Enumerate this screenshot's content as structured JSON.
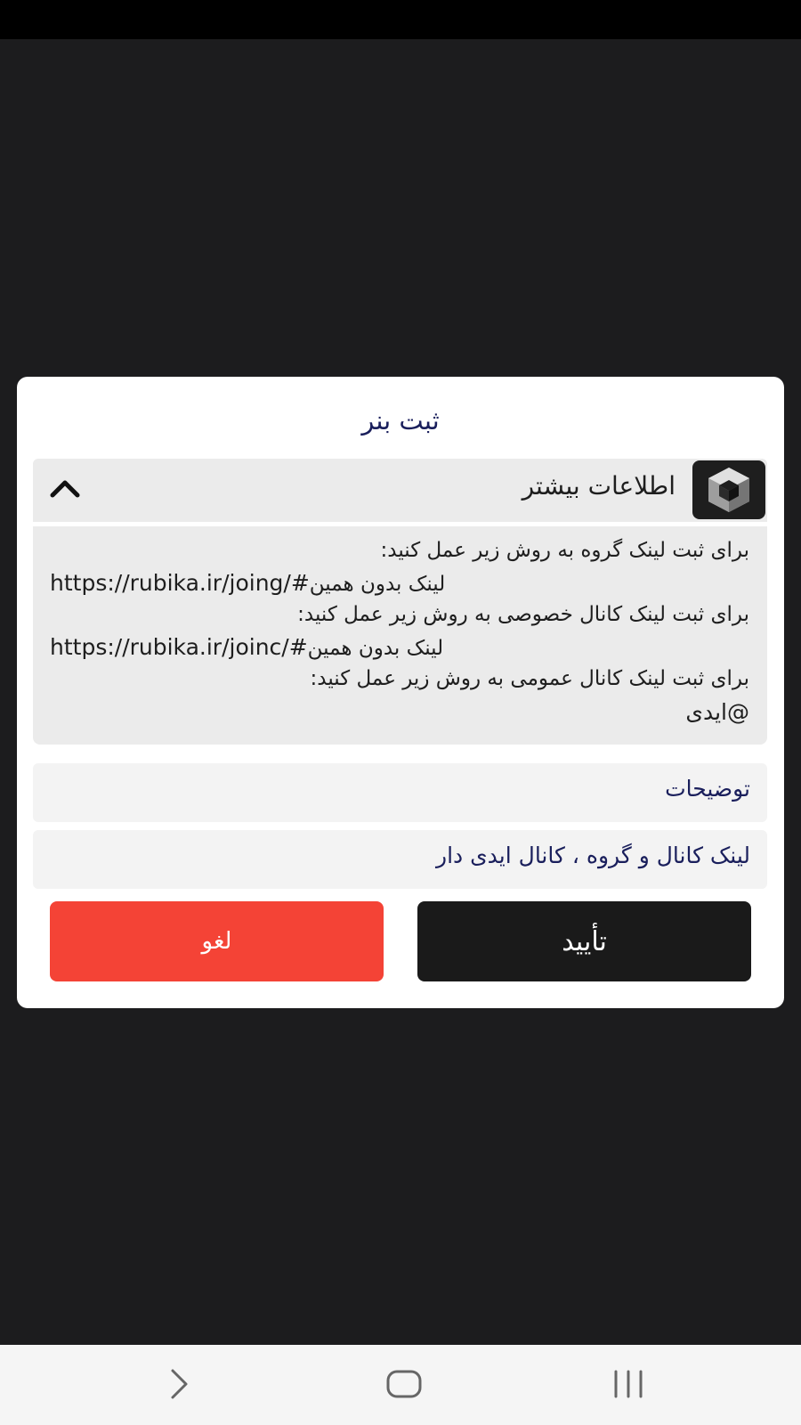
{
  "dialog": {
    "title": "ثبت بنر",
    "info_section": {
      "title": "اطلاعات بیشتر",
      "expanded": true,
      "lines": [
        {
          "text": "برای ثبت لینک گروه به روش زیر عمل کنید:"
        },
        {
          "url": "https://rubika.ir/joing/#",
          "suffix": "لینک بدون همین"
        },
        {
          "text": "برای ثبت لینک کانال خصوصی به روش زیر عمل کنید:"
        },
        {
          "url": "https://rubika.ir/joinc/#",
          "suffix": "لینک بدون همین"
        },
        {
          "text": "برای ثبت لینک کانال عمومی به روش زیر عمل کنید:"
        },
        {
          "text": "@ایدی"
        }
      ]
    },
    "description_field": {
      "placeholder": "توضیحات",
      "value": ""
    },
    "link_field": {
      "placeholder": "لینک کانال و گروه ، کانال ایدی دار",
      "value": ""
    },
    "buttons": {
      "cancel_label": "لغو",
      "confirm_label": "تأیید"
    }
  },
  "colors": {
    "backdrop": "#1c1c1e",
    "title": "#1a1f5c",
    "cancel": "#f44336",
    "confirm": "#1a1a1a",
    "panel": "#ebebeb"
  },
  "nav_bar": {
    "icons": [
      "back-icon",
      "home-icon",
      "recents-icon"
    ]
  }
}
